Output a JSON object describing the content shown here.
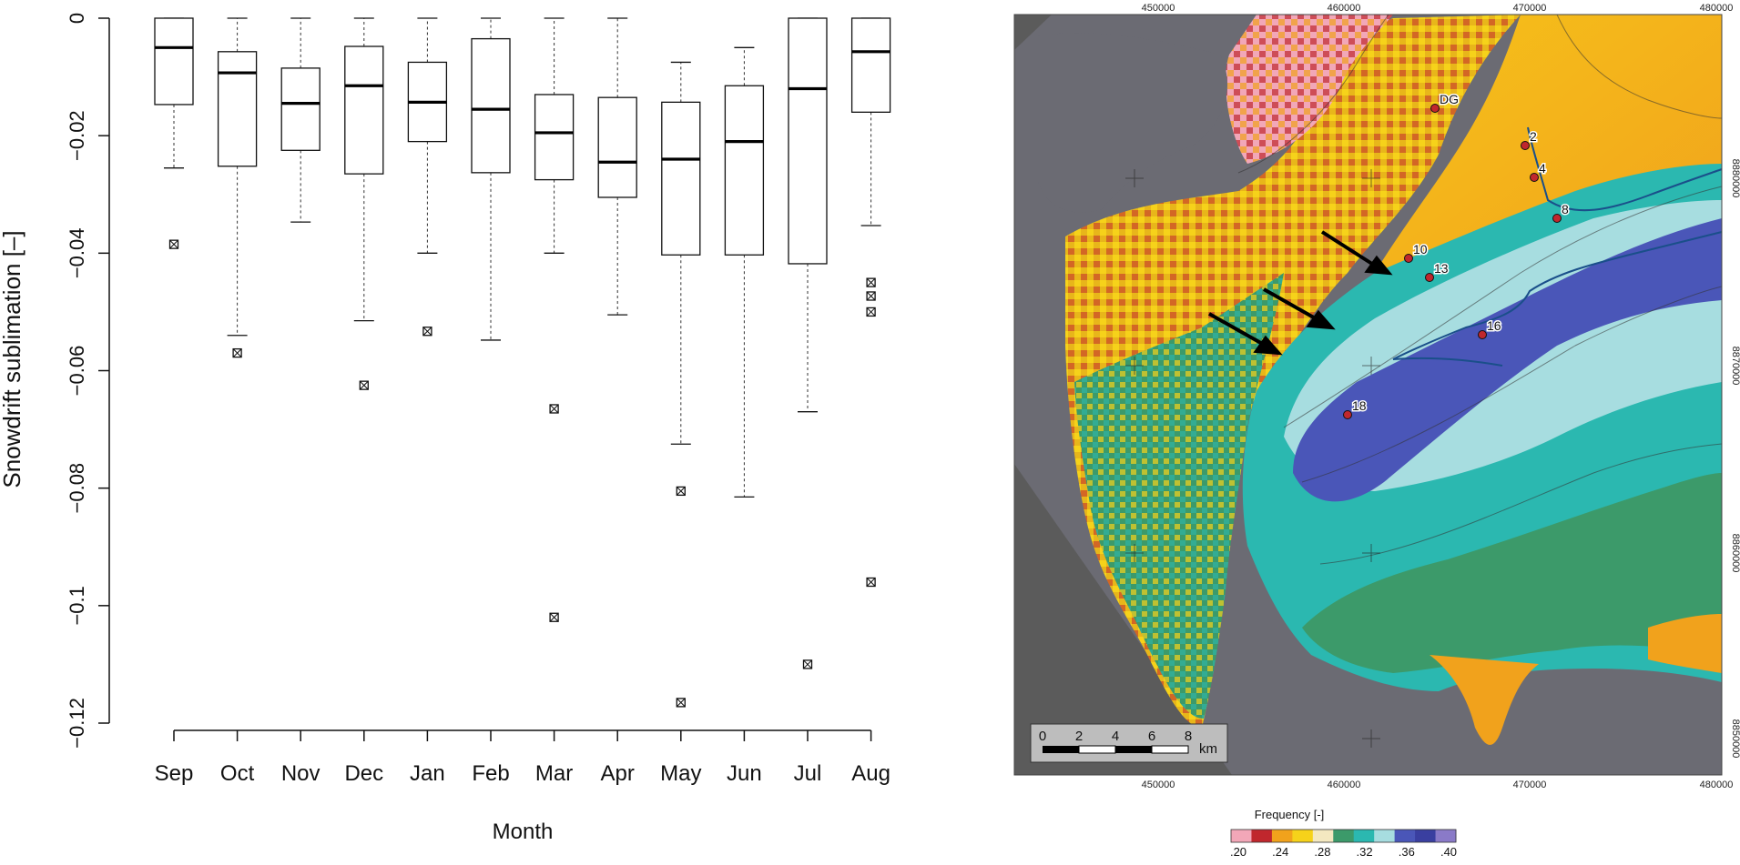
{
  "chart_data": [
    {
      "type": "boxplot",
      "xlabel": "Month",
      "ylabel": "Snowdrift sublimation [–]",
      "ylim": [
        -0.12,
        0
      ],
      "yticks": [
        "0",
        "−0.02",
        "−0.04",
        "−0.06",
        "−0.08",
        "−0.1",
        "−0.12"
      ],
      "ytick_values": [
        0,
        -0.02,
        -0.04,
        -0.06,
        -0.08,
        -0.1,
        -0.12
      ],
      "categories": [
        "Sep",
        "Oct",
        "Nov",
        "Dec",
        "Jan",
        "Feb",
        "Mar",
        "Apr",
        "May",
        "Jun",
        "Jul",
        "Aug"
      ],
      "boxes": [
        {
          "month": "Sep",
          "whisker_low": -0.0255,
          "q1": -0.0147,
          "median": -0.005,
          "q3": 0.0,
          "whisker_high": 0.0,
          "outliers": [
            -0.0385
          ]
        },
        {
          "month": "Oct",
          "whisker_low": -0.054,
          "q1": -0.0252,
          "median": -0.0093,
          "q3": -0.0057,
          "whisker_high": 0.0,
          "outliers": [
            -0.057
          ]
        },
        {
          "month": "Nov",
          "whisker_low": -0.0347,
          "q1": -0.0225,
          "median": -0.0145,
          "q3": -0.0085,
          "whisker_high": 0.0,
          "outliers": []
        },
        {
          "month": "Dec",
          "whisker_low": -0.0515,
          "q1": -0.0265,
          "median": -0.0115,
          "q3": -0.0048,
          "whisker_high": 0.0,
          "outliers": [
            -0.0625
          ]
        },
        {
          "month": "Jan",
          "whisker_low": -0.04,
          "q1": -0.021,
          "median": -0.0143,
          "q3": -0.0075,
          "whisker_high": 0.0,
          "outliers": [
            -0.0533
          ]
        },
        {
          "month": "Feb",
          "whisker_low": -0.0548,
          "q1": -0.0263,
          "median": -0.0155,
          "q3": -0.0035,
          "whisker_high": 0.0,
          "outliers": []
        },
        {
          "month": "Mar",
          "whisker_low": -0.04,
          "q1": -0.0275,
          "median": -0.0195,
          "q3": -0.013,
          "whisker_high": 0.0,
          "outliers": [
            -0.0665,
            -0.102
          ]
        },
        {
          "month": "Apr",
          "whisker_low": -0.0505,
          "q1": -0.0305,
          "median": -0.0245,
          "q3": -0.0135,
          "whisker_high": 0.0,
          "outliers": []
        },
        {
          "month": "May",
          "whisker_low": -0.0725,
          "q1": -0.0403,
          "median": -0.024,
          "q3": -0.0143,
          "whisker_high": -0.0075,
          "outliers": [
            -0.0805,
            -0.1165
          ]
        },
        {
          "month": "Jun",
          "whisker_low": -0.0815,
          "q1": -0.0403,
          "median": -0.021,
          "q3": -0.0115,
          "whisker_high": -0.005,
          "outliers": []
        },
        {
          "month": "Jul",
          "whisker_low": -0.067,
          "q1": -0.0418,
          "median": -0.012,
          "q3": 0.0,
          "whisker_high": 0.0,
          "outliers": [
            -0.11
          ]
        },
        {
          "month": "Aug",
          "whisker_low": -0.0353,
          "q1": -0.016,
          "median": -0.0057,
          "q3": 0.0,
          "whisker_high": 0.0,
          "outliers": [
            -0.045,
            -0.0473,
            -0.05,
            -0.096
          ]
        }
      ]
    },
    {
      "type": "heatmap",
      "x_ticks": [
        "450000",
        "460000",
        "470000",
        "480000"
      ],
      "y_ticks": [
        "8880000",
        "8870000",
        "8860000",
        "8850000"
      ],
      "sites": [
        "DG",
        "2",
        "4",
        "8",
        "10",
        "13",
        "16",
        "18"
      ],
      "scalebar": {
        "ticks": [
          "0",
          "2",
          "4",
          "6",
          "8"
        ],
        "unit": "km"
      },
      "legend": {
        "title": "Frequency [-]",
        "ticks": [
          ".20",
          ".24",
          ".28",
          ".32",
          ".36",
          ".40"
        ],
        "colors": [
          "#f2a7b8",
          "#c0272d",
          "#f1a21c",
          "#f6d21a",
          "#f4e8c0",
          "#3c9a6a",
          "#2bb8b0",
          "#a7dde0",
          "#4a56b8",
          "#3a3fa0",
          "#8a7ac8"
        ]
      },
      "colors": {
        "land_mask": "#6b6b73",
        "outside": "#5b5b5b"
      }
    }
  ]
}
